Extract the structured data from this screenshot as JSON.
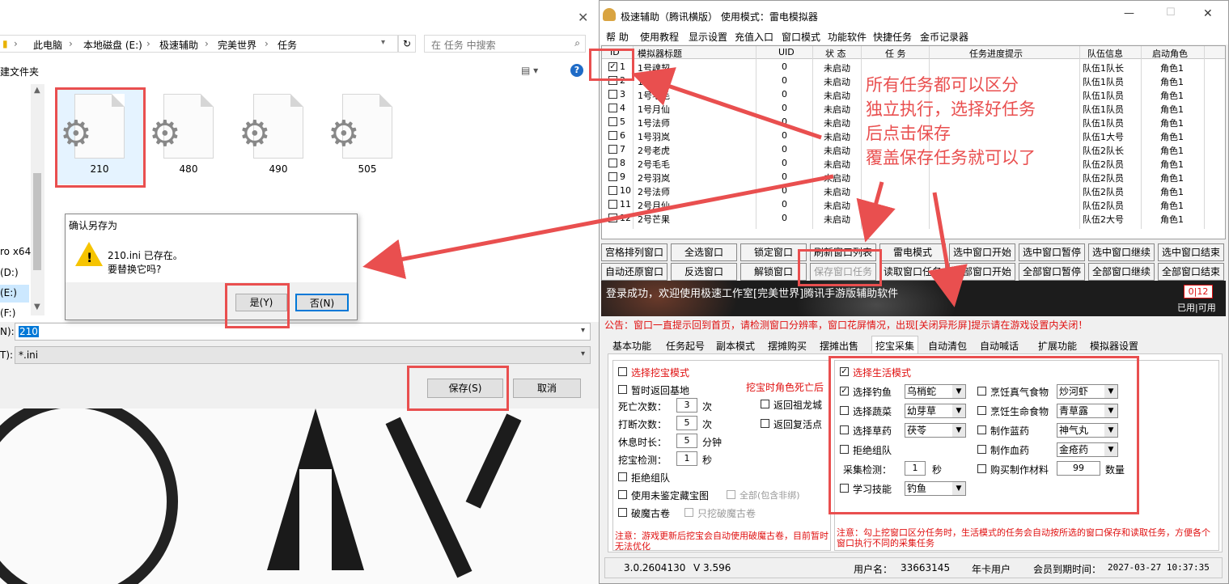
{
  "file_dialog": {
    "breadcrumb": [
      "此电脑",
      "本地磁盘 (E:)",
      "极速辅助",
      "完美世界",
      "任务"
    ],
    "search_placeholder": "在 任务 中搜索",
    "new_folder": "建文件夹",
    "nav_items": [
      "ro x64",
      "(D:)",
      "(E:)",
      "(F:)"
    ],
    "files": [
      "210",
      "480",
      "490",
      "505"
    ],
    "filename_label": "N):",
    "filename_value": "210",
    "filetype_label": "T):",
    "filetype_value": "*.ini",
    "save_button": "保存(S)",
    "cancel_button": "取消"
  },
  "confirm_dialog": {
    "title": "确认另存为",
    "message_line1": "210.ini 已存在。",
    "message_line2": "要替换它吗?",
    "yes_button": "是(Y)",
    "no_button": "否(N)"
  },
  "app": {
    "title": "极速辅助（腾讯横版）   使用模式：雷电模拟器",
    "menu": [
      "帮 助",
      "使用教程",
      "显示设置",
      "充值入口",
      "窗口模式",
      "功能软件",
      "快捷任务",
      "金币记录器"
    ],
    "grid_headers": [
      "ID",
      "模拟器标题",
      "UID",
      "状 态",
      "任 务",
      "任务进度提示",
      "队伍信息",
      "启动角色"
    ],
    "rows": [
      {
        "id": "1",
        "title": "1号魂契",
        "uid": "0",
        "status": "未启动",
        "team": "队伍1队长",
        "role": "角色1",
        "checked": true
      },
      {
        "id": "2",
        "title": "1号老虎",
        "uid": "0",
        "status": "未启动",
        "team": "队伍1队员",
        "role": "角色1",
        "checked": false
      },
      {
        "id": "3",
        "title": "1号毛毛",
        "uid": "0",
        "status": "未启动",
        "team": "队伍1队员",
        "role": "角色1",
        "checked": false
      },
      {
        "id": "4",
        "title": "1号月仙",
        "uid": "0",
        "status": "未启动",
        "team": "队伍1队员",
        "role": "角色1",
        "checked": false
      },
      {
        "id": "5",
        "title": "1号法师",
        "uid": "0",
        "status": "未启动",
        "team": "队伍1队员",
        "role": "角色1",
        "checked": false
      },
      {
        "id": "6",
        "title": "1号羽岚",
        "uid": "0",
        "status": "未启动",
        "team": "队伍1大号",
        "role": "角色1",
        "checked": false
      },
      {
        "id": "7",
        "title": "2号老虎",
        "uid": "0",
        "status": "未启动",
        "team": "队伍2队长",
        "role": "角色1",
        "checked": false
      },
      {
        "id": "8",
        "title": "2号毛毛",
        "uid": "0",
        "status": "未启动",
        "team": "队伍2队员",
        "role": "角色1",
        "checked": false
      },
      {
        "id": "9",
        "title": "2号羽岚",
        "uid": "0",
        "status": "未启动",
        "team": "队伍2队员",
        "role": "角色1",
        "checked": false
      },
      {
        "id": "10",
        "title": "2号法师",
        "uid": "0",
        "status": "未启动",
        "team": "队伍2队员",
        "role": "角色1",
        "checked": false
      },
      {
        "id": "11",
        "title": "2号月仙",
        "uid": "0",
        "status": "未启动",
        "team": "队伍2队员",
        "role": "角色1",
        "checked": false
      },
      {
        "id": "12",
        "title": "2号芒果",
        "uid": "0",
        "status": "未启动",
        "team": "队伍2大号",
        "role": "角色1",
        "checked": false
      }
    ],
    "buttons_row1": [
      "宫格排列窗口",
      "全选窗口",
      "锁定窗口",
      "刷新窗口列表",
      "雷电模式",
      "选中窗口开始",
      "选中窗口暂停",
      "选中窗口继续",
      "选中窗口结束"
    ],
    "buttons_row2": [
      "自动还原窗口",
      "反选窗口",
      "解锁窗口",
      "保存窗口任务",
      "读取窗口任务",
      "全部窗口开始",
      "全部窗口暂停",
      "全部窗口继续",
      "全部窗口结束"
    ],
    "banner_text": "登录成功，欢迎使用极速工作室[完美世界]腾讯手游版辅助软件",
    "counter": "0|12",
    "counter_label": "已用|可用",
    "notice": "公告：窗口一直提示回到首页，请检测窗口分辨率，窗口花屏情况，出现[关闭异形屏]提示请在游戏设置内关闭！",
    "tabs": [
      "基本功能",
      "任务起号",
      "副本模式",
      "摆摊购买",
      "摆摊出售",
      "挖宝采集",
      "自动清包",
      "自动喊话",
      "扩展功能",
      "模拟器设置"
    ],
    "dig": {
      "mode": "选择挖宝模式",
      "return_base": "暂时返回基地",
      "death_note": "挖宝时角色死亡后",
      "death_count_label": "死亡次数：",
      "death_count": "3",
      "times_unit": "次",
      "return_city": "返回祖龙城",
      "interrupt_label": "打断次数：",
      "interrupt_count": "5",
      "times_unit2": "次",
      "revive": "返回复活点",
      "rest_label": "休息时长：",
      "rest_value": "5",
      "minute_unit": "分钟",
      "check_label": "挖宝检测：",
      "check_value": "1",
      "second_unit": "秒",
      "refuse_team": "拒绝组队",
      "use_unidentified": "使用未鉴定藏宝图",
      "all_including": "全部(包含非绑)",
      "broken_scroll": "破魔古卷",
      "only_scroll": "只挖破魔古卷",
      "note": "注意：游戏更新后挖宝会自动使用破魔古卷，目前暂时无法优化"
    },
    "life": {
      "mode": "选择生活模式",
      "fishing": "选择钓鱼",
      "fishing_value": "乌梢蛇",
      "cook_qi": "烹饪真气食物",
      "cook_qi_value": "炒河虾",
      "veg": "选择蔬菜",
      "veg_value": "幼芽草",
      "cook_life": "烹饪生命食物",
      "cook_life_value": "青草露",
      "herb": "选择草药",
      "herb_value": "茯苓",
      "make_blue": "制作蓝药",
      "make_blue_value": "神气丸",
      "refuse_team": "拒绝组队",
      "make_red": "制作血药",
      "make_red_value": "金疮药",
      "collect_label": "采集检测：",
      "collect_value": "1",
      "second_unit": "秒",
      "buy_material": "购买制作材料",
      "buy_qty": "99",
      "qty_unit": "数量",
      "learn_skill": "学习技能",
      "learn_value": "钓鱼",
      "note": "注意：勾上挖窗口区分任务时，生活模式的任务会自动按所选的窗口保存和读取任务，方便各个窗口执行不同的采集任务"
    },
    "status": {
      "version": "3.0.2604130",
      "v": "V 3.596",
      "user_label": "用户名：",
      "user_value": "33663145",
      "plan": "年卡用户",
      "expire_label": "会员到期时间：",
      "expire_value": "2027-03-27  10:37:35"
    }
  },
  "annotation": {
    "line1": "所有任务都可以区分",
    "line2": "独立执行，选择好任务",
    "line3": "后点击保存",
    "line4": "覆盖保存任务就可以了"
  },
  "colors": {
    "highlight": "#e94f4f",
    "notice_red": "#e01010",
    "check_blue": "#1e5aa8"
  }
}
